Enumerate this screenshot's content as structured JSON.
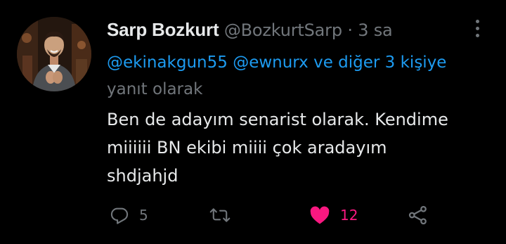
{
  "tweet": {
    "display_name": "Sarp Bozkurt",
    "handle": "@BozkurtSarp",
    "separator": "·",
    "time": "3 sa",
    "reply_to": {
      "mention_1": "@ekinakgun55",
      "mention_2": "@ewnurx",
      "connector": "ve",
      "others": "diğer 3 kişiye",
      "suffix": "yanıt olarak"
    },
    "text_lines": [
      "Ben de adayım senarist olarak. Kendime",
      "miiiiii BN ekibi miiii çok aradayım",
      "shdjahjd"
    ],
    "actions": {
      "reply": {
        "icon": "reply-icon",
        "count": "5"
      },
      "retweet": {
        "icon": "retweet-icon",
        "count": ""
      },
      "like": {
        "icon": "heart-icon",
        "count": "12",
        "liked": true
      },
      "share": {
        "icon": "share-icon"
      }
    }
  },
  "colors": {
    "background": "#000000",
    "text": "#e7e9ea",
    "muted": "#71767b",
    "link": "#1d9bf0",
    "like": "#f91880"
  }
}
